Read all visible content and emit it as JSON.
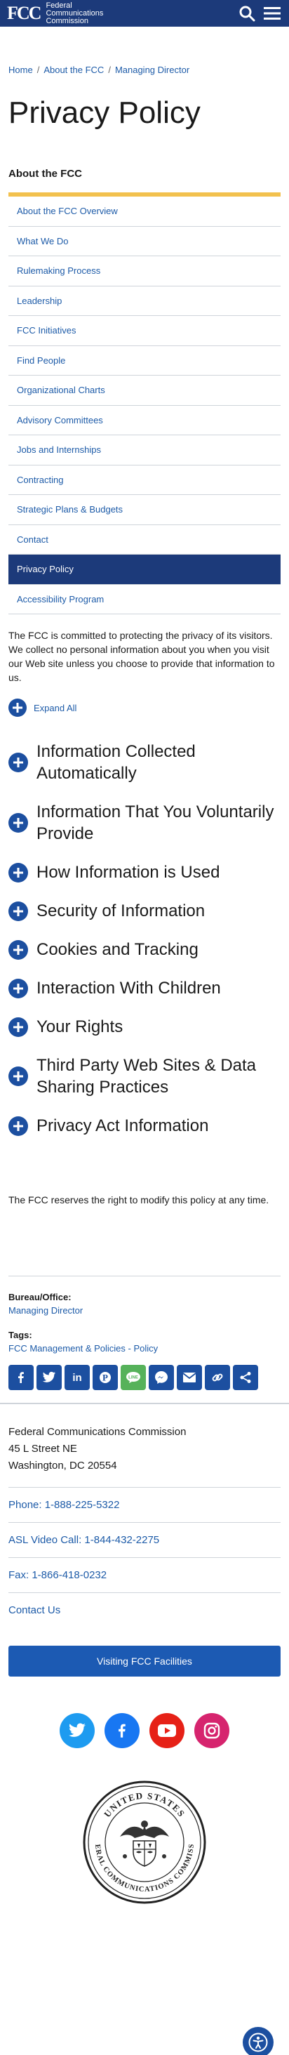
{
  "header": {
    "logo_mark": "FCC",
    "logo_lines": [
      "Federal",
      "Communications",
      "Commission"
    ]
  },
  "breadcrumb": [
    "Home",
    "About the FCC",
    "Managing Director"
  ],
  "page_title": "Privacy Policy",
  "sidenav": {
    "heading": "About the FCC",
    "items": [
      "About the FCC Overview",
      "What We Do",
      "Rulemaking Process",
      "Leadership",
      "FCC Initiatives",
      "Find People",
      "Organizational Charts",
      "Advisory Committees",
      "Jobs and Internships",
      "Contracting",
      "Strategic Plans & Budgets",
      "Contact",
      "Privacy Policy",
      "Accessibility Program"
    ],
    "active_index": 12
  },
  "intro": "The FCC is committed to protecting the privacy of its visitors. We collect no personal information about you when you visit our Web site unless you choose to provide that information to us.",
  "expand_all": "Expand All",
  "accordion": [
    "Information Collected Automatically",
    "Information That You Voluntarily Provide",
    "How Information is Used",
    "Security of Information",
    "Cookies and Tracking",
    "Interaction With Children",
    "Your Rights",
    "Third Party Web Sites & Data Sharing Practices",
    "Privacy Act Information"
  ],
  "reserve_note": "The FCC reserves the right to modify this policy at any time.",
  "meta": {
    "bureau_label": "Bureau/Office:",
    "bureau_value": "Managing Director",
    "tags_label": "Tags:",
    "tags_value": "FCC Management & Policies - Policy"
  },
  "share_icons": [
    "facebook-icon",
    "twitter-icon",
    "linkedin-icon",
    "pinterest-icon",
    "line-icon",
    "messenger-icon",
    "email-icon",
    "copy-link-icon",
    "share-icon"
  ],
  "footer": {
    "org": "Federal Communications Commission",
    "street": "45 L Street NE",
    "city": "Washington, DC 20554",
    "links": [
      "Phone: 1-888-225-5322",
      "ASL Video Call: 1-844-432-2275",
      "Fax: 1-866-418-0232",
      "Contact Us"
    ],
    "visit_button": "Visiting FCC Facilities",
    "seal_text_top": "UNITED STATES",
    "seal_text_bottom": "FEDERAL COMMUNICATIONS COMMISSION"
  },
  "colors": {
    "header_bg": "#1c3a7a",
    "accent_yellow": "#f2c14e",
    "link_blue": "#1d5ba8",
    "twitter": "#1d9bf0",
    "facebook": "#1877f2",
    "youtube": "#e62117",
    "instagram": "#d6246e"
  }
}
